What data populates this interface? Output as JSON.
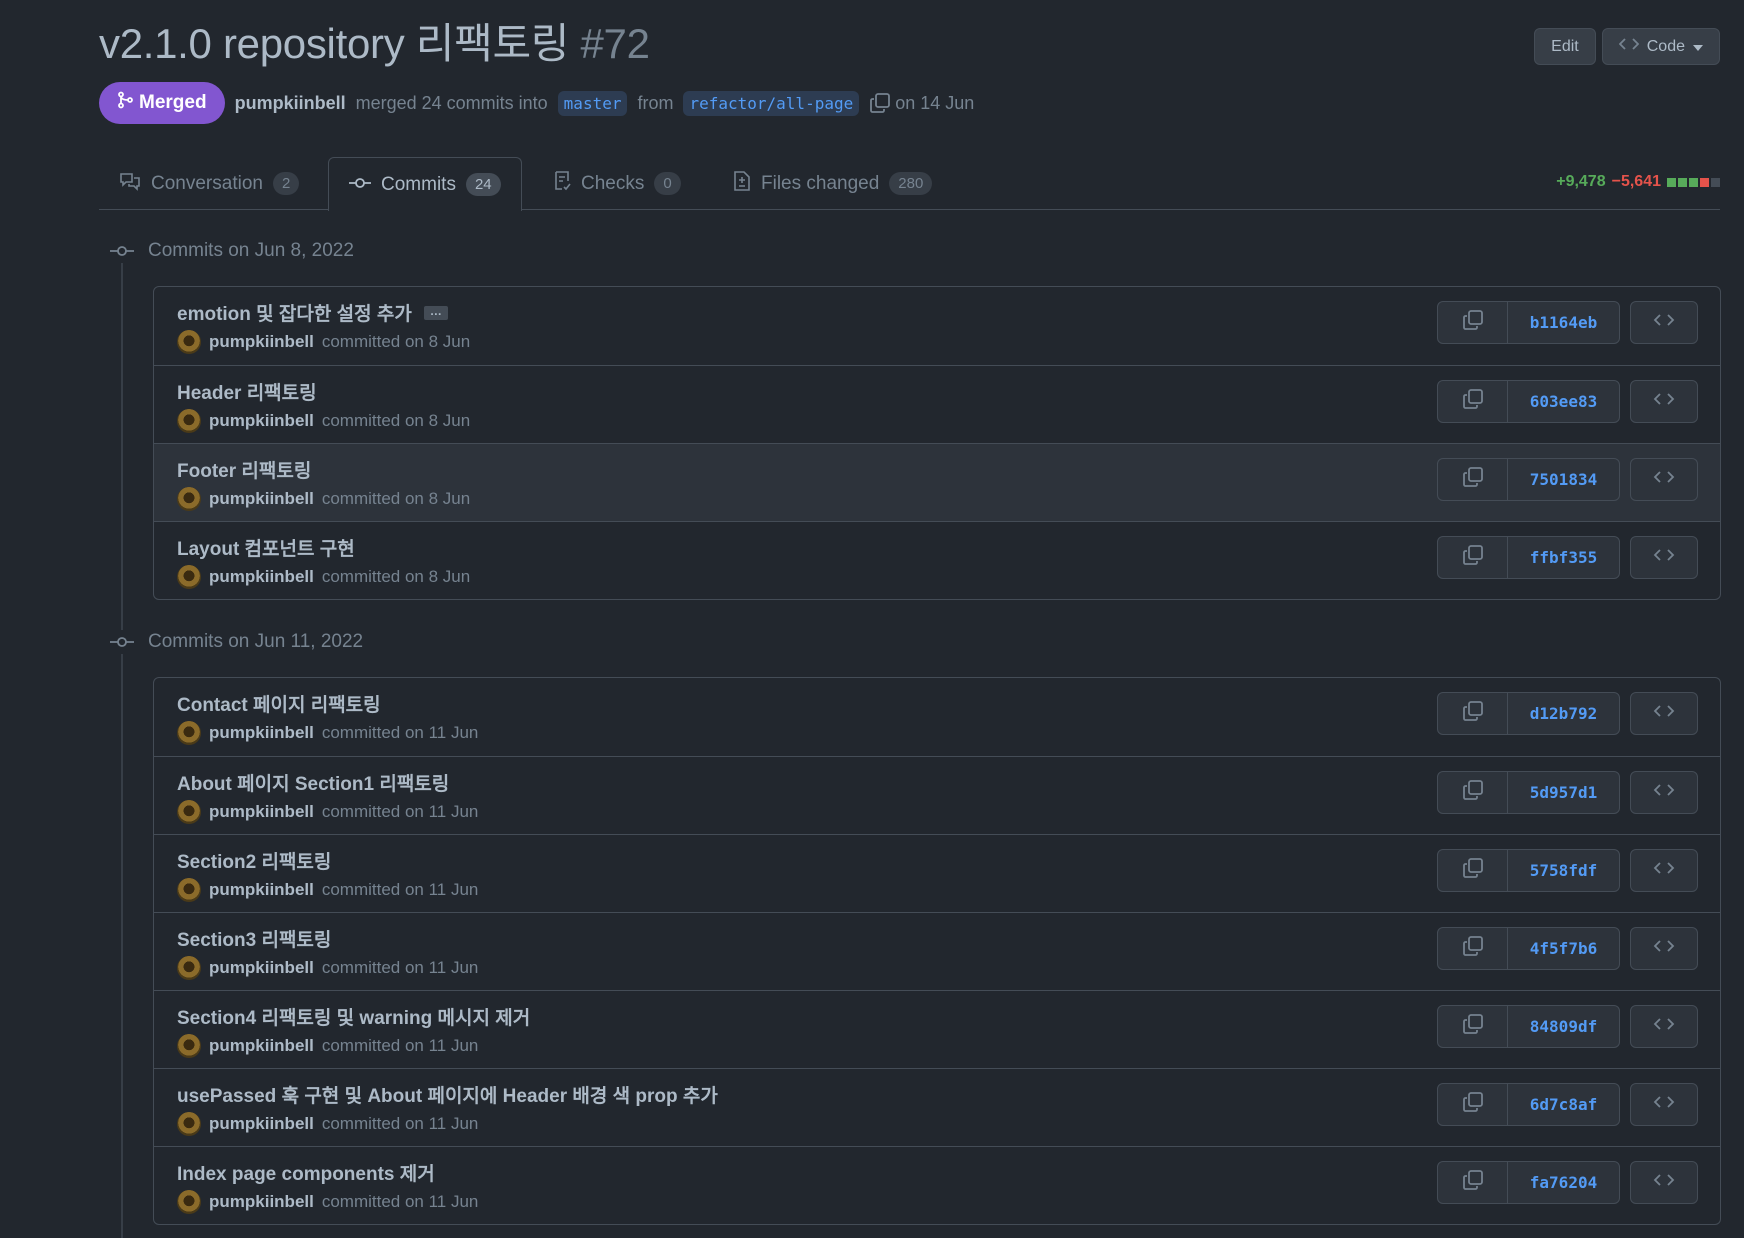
{
  "pr": {
    "title": "v2.1.0 repository 리팩토링",
    "number": "#72",
    "edit_label": "Edit",
    "code_label": "Code",
    "status": "Merged",
    "author": "pumpkiinbell",
    "merged_text": "merged 24 commits into",
    "base_branch": "master",
    "from_text": "from",
    "head_branch": "refactor/all-page",
    "date_text": "on 14 Jun"
  },
  "tabs": [
    {
      "label": "Conversation",
      "count": "2"
    },
    {
      "label": "Commits",
      "count": "24"
    },
    {
      "label": "Checks",
      "count": "0"
    },
    {
      "label": "Files changed",
      "count": "280"
    }
  ],
  "diffstat": {
    "additions": "+9,478",
    "deletions": "−5,641",
    "colors": [
      "#57ab5a",
      "#57ab5a",
      "#57ab5a",
      "#e5534b",
      "#444c56"
    ]
  },
  "groups": [
    {
      "heading": "Commits on Jun 8, 2022",
      "commits": [
        {
          "message": "emotion 및 잡다한 설정 추가",
          "author": "pumpkiinbell",
          "when": "committed on 8 Jun",
          "sha": "b1164eb",
          "ellipsis": "…"
        },
        {
          "message": "Header 리팩토링",
          "author": "pumpkiinbell",
          "when": "committed on 8 Jun",
          "sha": "603ee83"
        },
        {
          "message": "Footer 리팩토링",
          "author": "pumpkiinbell",
          "when": "committed on 8 Jun",
          "sha": "7501834"
        },
        {
          "message": "Layout 컴포넌트 구현",
          "author": "pumpkiinbell",
          "when": "committed on 8 Jun",
          "sha": "ffbf355"
        }
      ]
    },
    {
      "heading": "Commits on Jun 11, 2022",
      "commits": [
        {
          "message": "Contact 페이지 리팩토링",
          "author": "pumpkiinbell",
          "when": "committed on 11 Jun",
          "sha": "d12b792"
        },
        {
          "message": "About 페이지 Section1 리팩토링",
          "author": "pumpkiinbell",
          "when": "committed on 11 Jun",
          "sha": "5d957d1"
        },
        {
          "message": "Section2 리팩토링",
          "author": "pumpkiinbell",
          "when": "committed on 11 Jun",
          "sha": "5758fdf"
        },
        {
          "message": "Section3 리팩토링",
          "author": "pumpkiinbell",
          "when": "committed on 11 Jun",
          "sha": "4f5f7b6"
        },
        {
          "message": "Section4 리팩토링 및 warning 메시지 제거",
          "author": "pumpkiinbell",
          "when": "committed on 11 Jun",
          "sha": "84809df"
        },
        {
          "message": "usePassed 훅 구현 및 About 페이지에 Header 배경 색 prop 추가",
          "author": "pumpkiinbell",
          "when": "committed on 11 Jun",
          "sha": "6d7c8af"
        },
        {
          "message": "Index page components 제거",
          "author": "pumpkiinbell",
          "when": "committed on 11 Jun",
          "sha": "fa76204"
        }
      ]
    }
  ]
}
